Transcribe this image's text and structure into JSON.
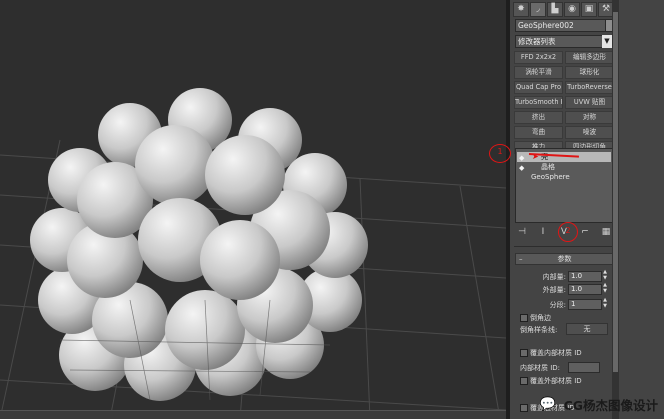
{
  "panel": {
    "tabs": [
      {
        "name": "create-tab",
        "glyph": "✸"
      },
      {
        "name": "modify-tab",
        "glyph": "◞"
      },
      {
        "name": "hierarchy-tab",
        "glyph": "▙"
      },
      {
        "name": "motion-tab",
        "glyph": "◉"
      },
      {
        "name": "display-tab",
        "glyph": "▣"
      },
      {
        "name": "utilities-tab",
        "glyph": "⚒"
      }
    ],
    "object_name": "GeoSphere002",
    "modifier_list": "修改器列表",
    "modifier_buttons": [
      "FFD 2x2x2",
      "编辑多边形",
      "涡轮平滑",
      "球形化",
      "Quad Cap Pro",
      "TurboReverse",
      "TurboSmooth Pro",
      "UVW 贴图",
      "挤出",
      "对称",
      "弯曲",
      "噪波",
      "推力",
      "四边形切角"
    ],
    "stack": [
      {
        "label": "壳",
        "selected": true
      },
      {
        "label": "晶格",
        "selected": false
      },
      {
        "label": "GeoSphere",
        "selected": false
      }
    ],
    "stack_tools": [
      "⊣",
      "I",
      "V",
      "⌐",
      "▦"
    ],
    "rollout_title": "参数",
    "params": {
      "inner_label": "内部量:",
      "inner_value": "1.0",
      "outer_label": "外部量:",
      "outer_value": "1.0",
      "segments_label": "分段:",
      "segments_value": "1",
      "bevel_edges_label": "倒角边",
      "bevel_spline_label": "倒角样条线:",
      "bevel_spline_button": "无",
      "override_inner_label": "覆盖内部材质 ID",
      "inner_mat_label": "内部材质 ID:",
      "override_outer_label": "覆盖外部材质 ID",
      "override_edge_label": "覆盖边材质 ID"
    }
  },
  "annotations": {
    "first": "1",
    "second": "2"
  },
  "watermark": "CG杨杰图像设计",
  "colors": {
    "viewport_bg": "#2e2e2e",
    "panel_bg": "#444444",
    "annotation": "#e01515",
    "sphere": "#d8d8d8"
  }
}
